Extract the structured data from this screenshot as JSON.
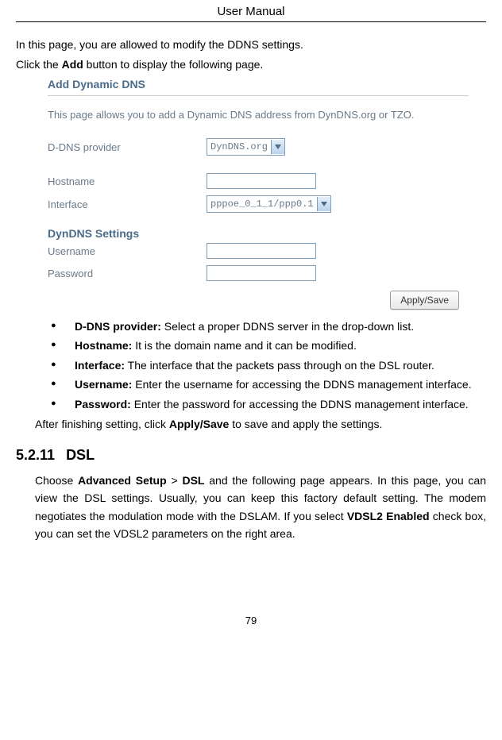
{
  "header": "User Manual",
  "intro": {
    "line1": "In this page, you are allowed to modify the DDNS settings.",
    "line2_pre": "Click the ",
    "line2_bold": "Add",
    "line2_post": " button to display the following page."
  },
  "screenshot": {
    "title": "Add Dynamic DNS",
    "description": "This page allows you to add a Dynamic DNS address from DynDNS.org or TZO.",
    "rows": {
      "provider_label": "D-DNS provider",
      "provider_value": "DynDNS.org",
      "hostname_label": "Hostname",
      "interface_label": "Interface",
      "interface_value": "pppoe_0_1_1/ppp0.1"
    },
    "subtitle": "DynDNS Settings",
    "subrows": {
      "username_label": "Username",
      "password_label": "Password"
    },
    "button": "Apply/Save"
  },
  "bullets": [
    {
      "label": "D-DNS provider:",
      "text": " Select a proper DDNS server in the drop-down list."
    },
    {
      "label": "Hostname:",
      "text": " It is the domain name and it can be modified."
    },
    {
      "label": "Interface:",
      "text": " The interface that the packets pass through on the DSL router."
    },
    {
      "label": "Username:",
      "text": " Enter the username for accessing the DDNS management interface."
    },
    {
      "label": "Password:",
      "text": " Enter the password for accessing the DDNS management interface."
    }
  ],
  "after_bullets": {
    "pre": "After finishing setting, click ",
    "bold": "Apply/Save",
    "post": " to save and apply the settings."
  },
  "section": {
    "number": "5.2.11",
    "title": "DSL"
  },
  "body": {
    "p1_pre": "Choose ",
    "p1_b1": "Advanced Setup",
    "p1_gt": " > ",
    "p1_b2": "DSL",
    "p1_mid": " and the following page appears. In this page, you can view the DSL settings. Usually, you can keep this factory default setting. The modem negotiates the modulation mode with the DSLAM. If you select ",
    "p1_b3": "VDSL2 Enabled",
    "p1_post": " check box, you can set the VDSL2 parameters on the right area."
  },
  "page_number": "79"
}
